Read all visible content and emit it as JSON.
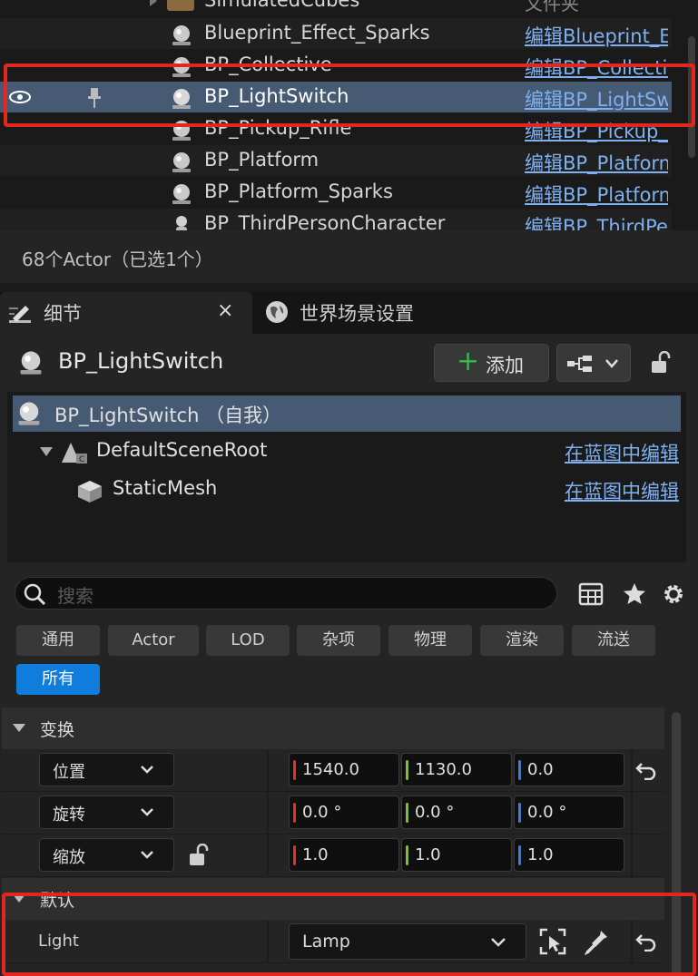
{
  "outliner": {
    "partial_top_name": "SimulatedCubes",
    "partial_top_header": "文件夹",
    "rows": [
      {
        "name": "Blueprint_Effect_Sparks",
        "link": "编辑Blueprint_Effect_Sparks",
        "icon": "blueprint-actor-icon"
      },
      {
        "name": "BP_Collective",
        "link": "编辑BP_Collective",
        "icon": "blueprint-actor-icon"
      },
      {
        "name": "BP_LightSwitch",
        "link": "编辑BP_LightSwitch",
        "icon": "blueprint-actor-icon",
        "selected": true
      },
      {
        "name": "BP_Pickup_Rifle",
        "link": "编辑BP_Pickup_Rifle",
        "icon": "blueprint-actor-icon"
      },
      {
        "name": "BP_Platform",
        "link": "编辑BP_Platform",
        "icon": "blueprint-actor-icon"
      },
      {
        "name": "BP_Platform_Sparks",
        "link": "编辑BP_Platform_Sparks",
        "icon": "blueprint-actor-icon"
      },
      {
        "name": "BP_ThirdPersonCharacter",
        "link": "编辑BP_ThirdPersonCharacter",
        "icon": "character-icon"
      }
    ],
    "actor_count": "68个Actor（已选1个）"
  },
  "tabs": {
    "details": "细节",
    "world_settings": "世界场景设置"
  },
  "details": {
    "actor_name": "BP_LightSwitch",
    "add_label": "添加",
    "components": [
      {
        "label": "BP_LightSwitch （自我）",
        "edit": ""
      },
      {
        "label": "DefaultSceneRoot",
        "edit": "在蓝图中编辑"
      },
      {
        "label": "StaticMesh",
        "edit": "在蓝图中编辑"
      }
    ],
    "search_placeholder": "搜索",
    "filters": [
      "通用",
      "Actor",
      "LOD",
      "杂项",
      "物理",
      "渲染",
      "流送",
      "所有"
    ],
    "active_filter": "所有"
  },
  "transform": {
    "section_label": "变换",
    "rows": [
      {
        "label": "位置",
        "x": "1540.0",
        "y": "1130.0",
        "z": "0.0"
      },
      {
        "label": "旋转",
        "x": "0.0 °",
        "y": "0.0 °",
        "z": "0.0 °"
      },
      {
        "label": "缩放",
        "x": "1.0",
        "y": "1.0",
        "z": "1.0"
      }
    ]
  },
  "default": {
    "section_label": "默认",
    "property_label": "Light",
    "property_value": "Lamp"
  },
  "colors": {
    "selection": "#465a73",
    "link": "#7fb1f0",
    "accent_blue": "#0f7ddb",
    "axis_x": "#e0312a",
    "axis_y": "#7ac51f",
    "axis_z": "#2f80ed",
    "highlight_box": "#e3271f"
  }
}
